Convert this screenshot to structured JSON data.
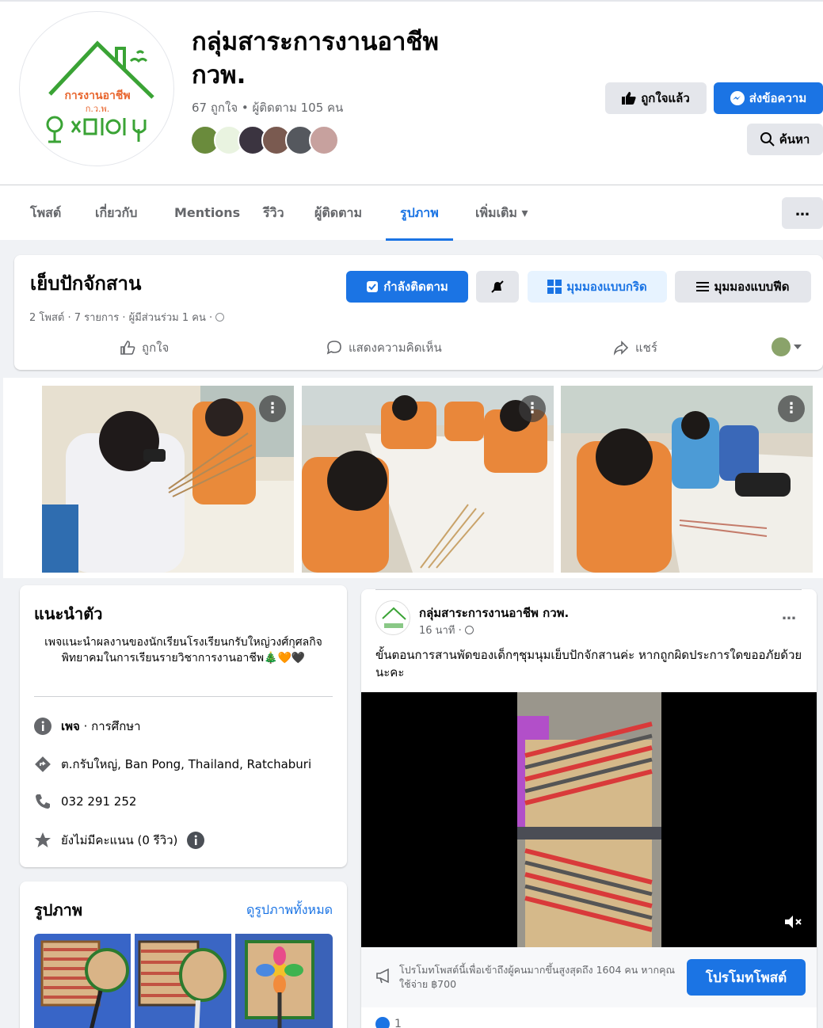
{
  "page": {
    "title_line1": "กลุ่มสาระการงานอาชีพ",
    "title_line2": "กวพ.",
    "stats": "67 ถูกใจ • ผู้ติดตาม 105 คน",
    "logo_text_top": "การงานอาชีพ",
    "logo_text_sub": "ก.ว.พ.",
    "liked_label": "ถูกใจแล้ว",
    "message_label": "ส่งข้อความ",
    "search_label": "ค้นหา"
  },
  "tabs": [
    "โพสต์",
    "เกี่ยวกับ",
    "Mentions",
    "รีวิว",
    "ผู้ติดตาม",
    "รูปภาพ",
    "เพิ่มเติม ▾"
  ],
  "tabs_more": "…",
  "album": {
    "title": "เย็บปักจักสาน",
    "meta": "2 โพสต์ · 7 รายการ · ผู้มีส่วนร่วม 1 คน ·",
    "following_label": "กำลังติดตาม",
    "grid_view_label": "มุมมองแบบกริด",
    "feed_view_label": "มุมมองแบบฟีด",
    "like_label": "ถูกใจ",
    "comment_label": "แสดงความคิดเห็น",
    "share_label": "แชร์"
  },
  "intro": {
    "heading": "แนะนำตัว",
    "bio": "เพจแนะนำผลงานของนักเรียนโรงเรียนกรับใหญ่วงศ์กุศลกิจพิทยาคมในการเรียนรายวิชาการงานอาชีพ🎄🧡🖤",
    "category_bold": "เพจ",
    "category_rest": " · การศึกษา",
    "location": "ต.กรับใหญ่, Ban Pong, Thailand, Ratchaburi",
    "phone": "032 291 252",
    "rating": "ยังไม่มีคะแนน (0 รีวิว)"
  },
  "photos_card": {
    "heading": "รูปภาพ",
    "see_all": "ดูรูปภาพทั้งหมด"
  },
  "post": {
    "author": "กลุ่มสาระการงานอาชีพ กวพ.",
    "time": "16 นาที ·",
    "text": "ขั้นตอนการสานพัดของเด็กๆชุมนุมเย็บปักจักสานค่ะ หากถูกผิดประการใดขออภัยด้วยนะคะ",
    "promo_text": "โปรโมทโพสต์นี้เพื่อเข้าถึงผู้คนมากขึ้นสูงสุดถึง 1604 คน หากคุณใช้จ่าย ฿700",
    "promo_button": "โปรโมทโพสต์",
    "reaction_count": "1",
    "more": "…"
  },
  "colors": {
    "accent": "#1b74e4",
    "green": "#3aa335"
  }
}
